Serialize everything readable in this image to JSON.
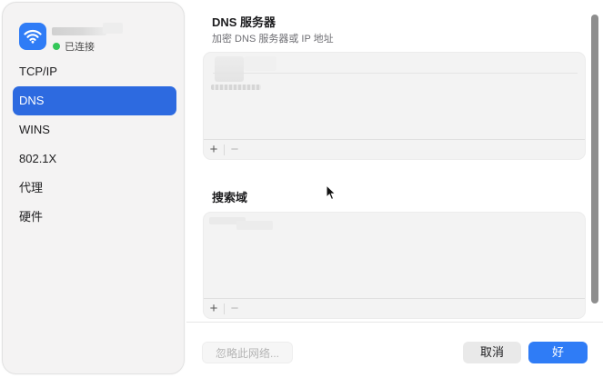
{
  "sidebar": {
    "network_status": "已连接",
    "status_color": "#34c759",
    "wifi_badge_color": "#2f7cf6",
    "items": [
      {
        "label": "TCP/IP",
        "active": false
      },
      {
        "label": "DNS",
        "active": true
      },
      {
        "label": "WINS",
        "active": false
      },
      {
        "label": "802.1X",
        "active": false
      },
      {
        "label": "代理",
        "active": false
      },
      {
        "label": "硬件",
        "active": false
      }
    ]
  },
  "dns": {
    "title": "DNS 服务器",
    "subtitle": "加密 DNS 服务器或 IP 地址",
    "add_label": "+",
    "remove_label": "−"
  },
  "search_domains": {
    "title": "搜索域",
    "add_label": "+",
    "remove_label": "−"
  },
  "footer": {
    "forget_label": "忽略此网络...",
    "cancel_label": "取消",
    "ok_label": "好"
  },
  "accent_color": "#2d6ae0"
}
